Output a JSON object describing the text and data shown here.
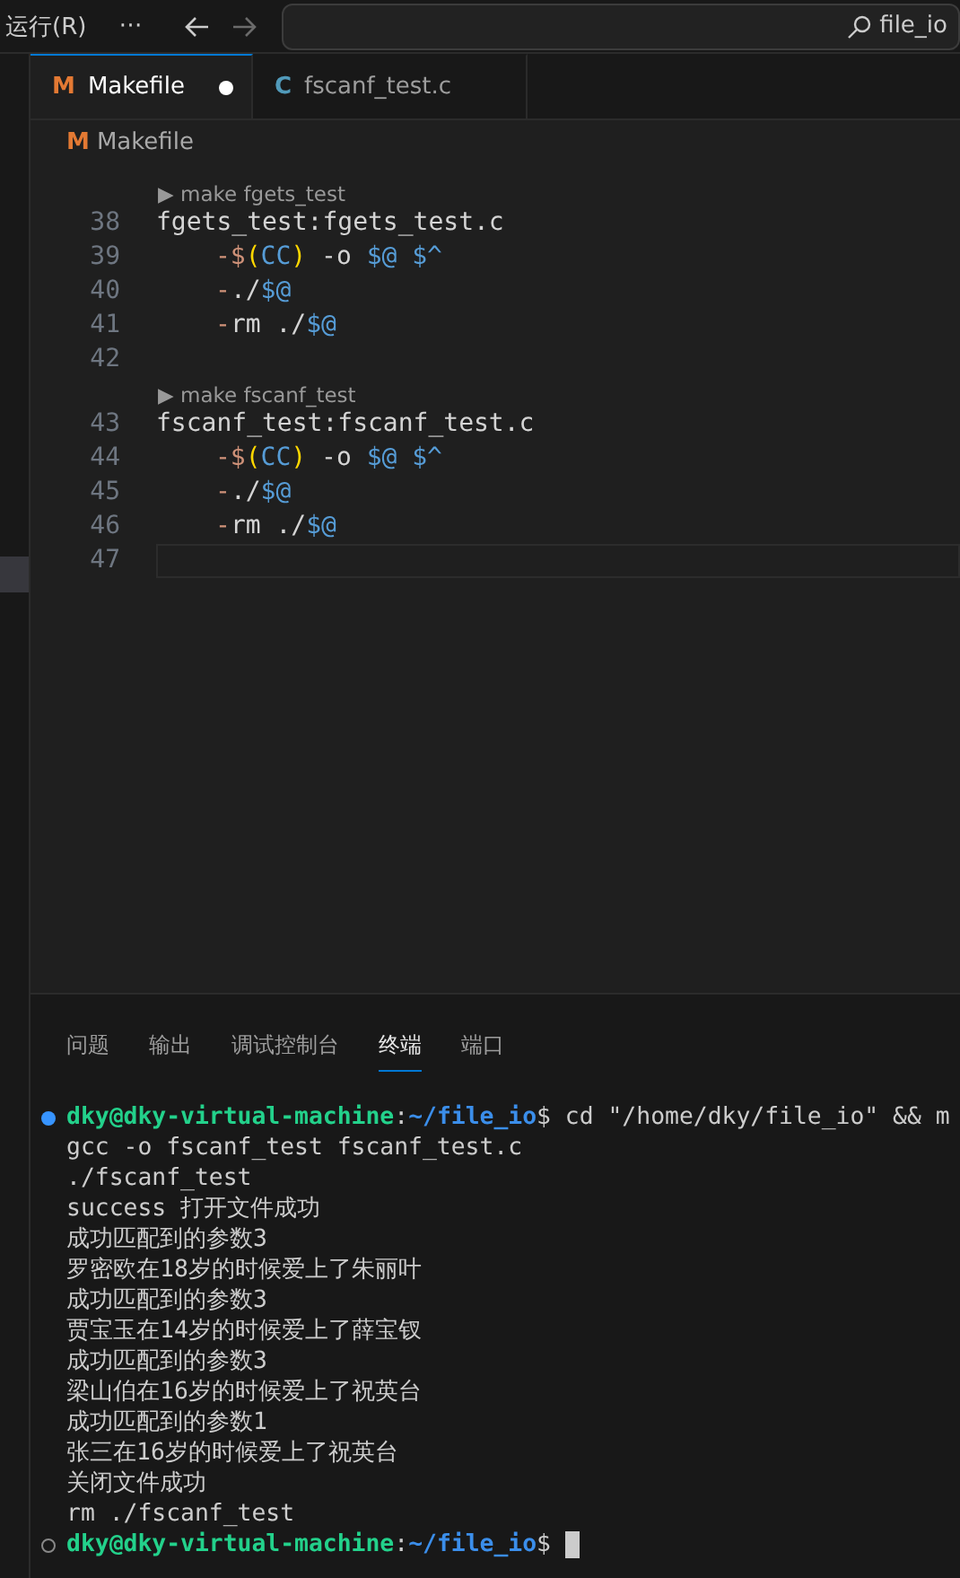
{
  "menu": {
    "items": [
      "运行(R)",
      "⋯"
    ],
    "back_enabled": true,
    "forward_enabled": false,
    "search": {
      "value": "file_io"
    }
  },
  "tabs": [
    {
      "icon": "M",
      "kind": "makefile",
      "label": "Makefile",
      "modified": true,
      "selected": true
    },
    {
      "icon": "C",
      "kind": "c",
      "label": "fscanf_test.c",
      "modified": false,
      "selected": false
    }
  ],
  "breadcrumb": {
    "icon": "M",
    "kind": "makefile",
    "label": "Makefile"
  },
  "code": [
    {
      "number": "38",
      "codelens": "▶ make fgets_test",
      "tokens": [
        {
          "kind": "plain",
          "text": "fgets_test:fgets_test.c"
        }
      ]
    },
    {
      "number": "39",
      "indented": true,
      "tokens": [
        {
          "kind": "op",
          "text": "-$"
        },
        {
          "kind": "bracket",
          "text": "("
        },
        {
          "kind": "var",
          "text": "CC"
        },
        {
          "kind": "bracket",
          "text": ")"
        },
        {
          "kind": "plain",
          "text": " -o "
        },
        {
          "kind": "var",
          "text": "$@ $^"
        }
      ]
    },
    {
      "number": "40",
      "indented": true,
      "tokens": [
        {
          "kind": "op",
          "text": "-"
        },
        {
          "kind": "plain",
          "text": "./"
        },
        {
          "kind": "var",
          "text": "$@"
        }
      ]
    },
    {
      "number": "41",
      "indented": true,
      "tokens": [
        {
          "kind": "op",
          "text": "-"
        },
        {
          "kind": "plain",
          "text": "rm ./"
        },
        {
          "kind": "var",
          "text": "$@"
        }
      ]
    },
    {
      "number": "42"
    },
    {
      "number": "43",
      "codelens": "▶ make fscanf_test",
      "tokens": [
        {
          "kind": "plain",
          "text": "fscanf_test:fscanf_test.c"
        }
      ]
    },
    {
      "number": "44",
      "indented": true,
      "tokens": [
        {
          "kind": "op",
          "text": "-$"
        },
        {
          "kind": "bracket",
          "text": "("
        },
        {
          "kind": "var",
          "text": "CC"
        },
        {
          "kind": "bracket",
          "text": ")"
        },
        {
          "kind": "plain",
          "text": " -o "
        },
        {
          "kind": "var",
          "text": "$@ $^"
        }
      ]
    },
    {
      "number": "45",
      "indented": true,
      "tokens": [
        {
          "kind": "op",
          "text": "-"
        },
        {
          "kind": "plain",
          "text": "./"
        },
        {
          "kind": "var",
          "text": "$@"
        }
      ]
    },
    {
      "number": "46",
      "indented": true,
      "tokens": [
        {
          "kind": "op",
          "text": "-"
        },
        {
          "kind": "plain",
          "text": "rm ./"
        },
        {
          "kind": "var",
          "text": "$@"
        }
      ]
    },
    {
      "number": "47",
      "current": true
    }
  ],
  "panel_tabs": [
    {
      "label": "问题",
      "selected": false
    },
    {
      "label": "输出",
      "selected": false
    },
    {
      "label": "调试控制台",
      "selected": false
    },
    {
      "label": "终端",
      "selected": true
    },
    {
      "label": "端口",
      "selected": false
    }
  ],
  "terminal": [
    {
      "kind": "prompt",
      "succeeded": true,
      "parts": [
        {
          "kind": "user",
          "text": "dky@dky-virtual-machine"
        },
        {
          "kind": "plain",
          "text": ":"
        },
        {
          "kind": "path",
          "text": "~/file_io"
        },
        {
          "kind": "plain",
          "text": "$ cd \"/home/dky/file_io\" && m"
        }
      ]
    },
    {
      "kind": "output",
      "text": "gcc -o fscanf_test fscanf_test.c"
    },
    {
      "kind": "output",
      "text": "./fscanf_test"
    },
    {
      "kind": "output",
      "text": "success 打开文件成功"
    },
    {
      "kind": "output",
      "text": "成功匹配到的参数3"
    },
    {
      "kind": "output",
      "text": "罗密欧在18岁的时候爱上了朱丽叶"
    },
    {
      "kind": "output",
      "text": "成功匹配到的参数3"
    },
    {
      "kind": "output",
      "text": "贾宝玉在14岁的时候爱上了薛宝钗"
    },
    {
      "kind": "output",
      "text": "成功匹配到的参数3"
    },
    {
      "kind": "output",
      "text": "梁山伯在16岁的时候爱上了祝英台"
    },
    {
      "kind": "output",
      "text": "成功匹配到的参数1"
    },
    {
      "kind": "output",
      "text": "张三在16岁的时候爱上了祝英台"
    },
    {
      "kind": "output",
      "text": "关闭文件成功"
    },
    {
      "kind": "output",
      "text": "rm ./fscanf_test"
    },
    {
      "kind": "prompt",
      "succeeded": false,
      "cursor": true,
      "parts": [
        {
          "kind": "user",
          "text": "dky@dky-virtual-machine"
        },
        {
          "kind": "plain",
          "text": ":"
        },
        {
          "kind": "path",
          "text": "~/file_io"
        },
        {
          "kind": "plain",
          "text": "$"
        }
      ]
    }
  ]
}
